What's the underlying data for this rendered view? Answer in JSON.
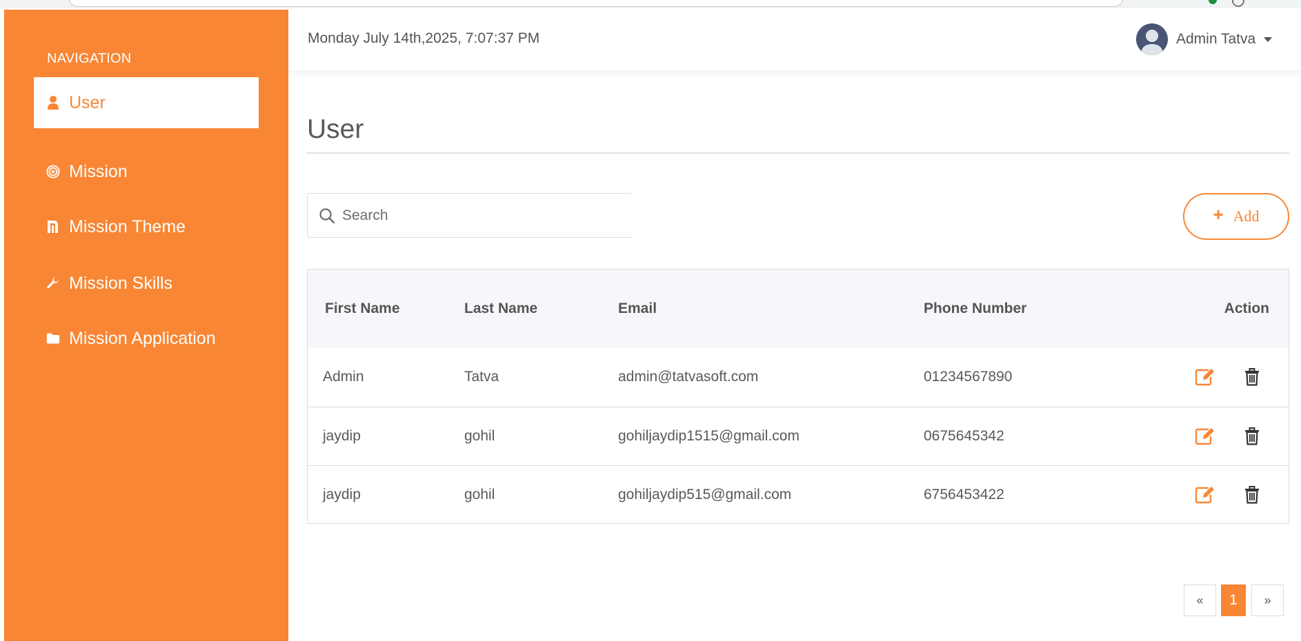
{
  "sidebar": {
    "heading": "NAVIGATION",
    "items": [
      {
        "label": "User",
        "icon": "user-icon",
        "active": true
      },
      {
        "label": "Mission",
        "icon": "target-icon",
        "active": false
      },
      {
        "label": "Mission Theme",
        "icon": "theme-icon",
        "active": false
      },
      {
        "label": "Mission Skills",
        "icon": "wrench-icon",
        "active": false
      },
      {
        "label": "Mission Application",
        "icon": "folder-icon",
        "active": false
      }
    ]
  },
  "header": {
    "datetime": "Monday July 14th,2025, 7:07:37 PM",
    "user_name": "Admin Tatva",
    "avatar_icon": "avatar-icon"
  },
  "main": {
    "title": "User",
    "search": {
      "placeholder": "Search",
      "value": ""
    },
    "add_label": "Add",
    "table": {
      "headers": [
        "First Name",
        "Last Name",
        "Email",
        "Phone Number",
        "Action"
      ],
      "rows": [
        {
          "first": "Admin",
          "last": "Tatva",
          "email": "admin@tatvasoft.com",
          "phone": "01234567890"
        },
        {
          "first": "jaydip",
          "last": "gohil",
          "email": "gohiljaydip1515@gmail.com",
          "phone": "0675645342"
        },
        {
          "first": "jaydip",
          "last": "gohil",
          "email": "gohiljaydip515@gmail.com",
          "phone": "6756453422"
        }
      ]
    },
    "pagination": {
      "prev": "«",
      "current": "1",
      "next": "»"
    }
  },
  "colors": {
    "accent": "#f88634",
    "text": "#595959",
    "table_header_bg": "#f6f7fb"
  }
}
